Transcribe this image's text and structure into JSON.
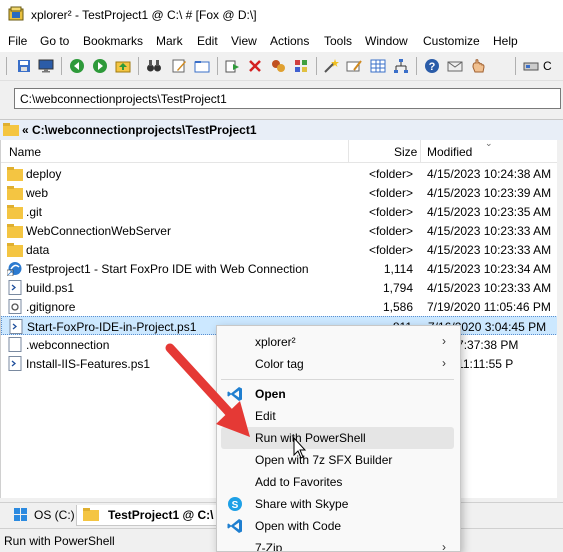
{
  "window": {
    "title": "xplorer² - TestProject1 @ C:\\ # [Fox @ D:\\]"
  },
  "menu": [
    "File",
    "Go to",
    "Bookmarks",
    "Mark",
    "Edit",
    "View",
    "Actions",
    "Tools",
    "Window",
    "Customize",
    "Help"
  ],
  "toolbar": {
    "drive_label": "C",
    "icons": [
      "save-icon",
      "monitor-icon",
      "back-icon",
      "forward-icon",
      "up-folder-icon",
      "binoculars-icon",
      "edit-icon",
      "folder-icon",
      "copy-icon",
      "delete-icon",
      "move-icon",
      "properties-icon",
      "wand-icon",
      "rename-icon",
      "grid-icon",
      "tree-icon",
      "help-icon",
      "mail-icon",
      "hand-icon",
      "drive-icon"
    ]
  },
  "address": {
    "value": "C:\\webconnectionprojects\\TestProject1"
  },
  "pathbar": {
    "text": "« C:\\webconnectionprojects\\TestProject1"
  },
  "columns": {
    "name": "Name",
    "size": "Size",
    "modified": "Modified"
  },
  "files": [
    {
      "name": "deploy",
      "size": "<folder>",
      "modified": "4/15/2023 10:24:38 AM",
      "icon": "folder-icon"
    },
    {
      "name": "web",
      "size": "<folder>",
      "modified": "4/15/2023 10:23:39 AM",
      "icon": "folder-icon"
    },
    {
      "name": ".git",
      "size": "<folder>",
      "modified": "4/15/2023 10:23:35 AM",
      "icon": "folder-icon"
    },
    {
      "name": "WebConnectionWebServer",
      "size": "<folder>",
      "modified": "4/15/2023 10:23:33 AM",
      "icon": "folder-icon"
    },
    {
      "name": "data",
      "size": "<folder>",
      "modified": "4/15/2023 10:23:33 AM",
      "icon": "folder-icon"
    },
    {
      "name": "Testproject1 - Start FoxPro IDE with Web Connection",
      "size": "1,114",
      "modified": "4/15/2023 10:23:34 AM",
      "icon": "shortcut-icon"
    },
    {
      "name": "build.ps1",
      "size": "1,794",
      "modified": "4/15/2023 10:23:33 AM",
      "icon": "powershell-file-icon"
    },
    {
      "name": ".gitignore",
      "size": "1,586",
      "modified": "7/19/2020 11:05:46 PM",
      "icon": "config-file-icon"
    },
    {
      "name": "Start-FoxPro-IDE-in-Project.ps1",
      "size": "811",
      "modified": "7/16/2020 3:04:45 PM",
      "icon": "powershell-file-icon",
      "selected": true
    },
    {
      "name": ".webconnection",
      "size": "",
      "modified": "2020 7:37:38 PM",
      "icon": "file-icon"
    },
    {
      "name": "Install-IIS-Features.ps1",
      "size": "",
      "modified": "2018 11:11:55 P",
      "icon": "powershell-file-icon"
    }
  ],
  "tabs": [
    {
      "label": "OS (C:)"
    },
    {
      "label": "TestProject1 @ C:\\"
    }
  ],
  "status": {
    "text": "Run with PowerShell"
  },
  "context_menu": {
    "items": [
      {
        "label": "xplorer²",
        "submenu": true
      },
      {
        "label": "Color tag",
        "submenu": true
      },
      {
        "label": "Open",
        "bold": true,
        "icon": "vscode-icon"
      },
      {
        "label": "Edit"
      },
      {
        "label": "Run with PowerShell",
        "hover": true
      },
      {
        "label": "Open with 7z SFX Builder"
      },
      {
        "label": "Add to Favorites"
      },
      {
        "label": "Share with Skype",
        "icon": "skype-icon"
      },
      {
        "label": "Open with Code",
        "icon": "vscode-icon"
      },
      {
        "label": "7-Zip",
        "submenu": true
      }
    ]
  },
  "colors": {
    "annotation_arrow": "#e53935",
    "selection": "#cce8ff",
    "folder": "#f4c542",
    "vscode": "#1f7fd0"
  }
}
